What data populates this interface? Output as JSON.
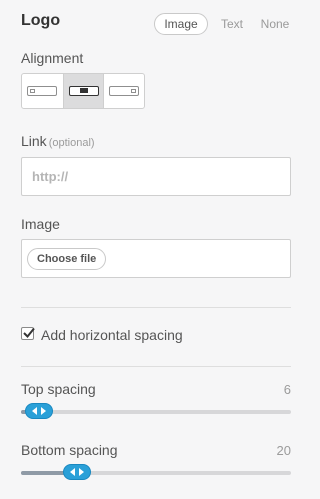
{
  "header": {
    "title": "Logo"
  },
  "mode_tabs": [
    "Image",
    "Text",
    "None"
  ],
  "alignment": {
    "label": "Alignment",
    "selected": "center",
    "options": [
      "left",
      "center",
      "right"
    ]
  },
  "link": {
    "label": "Link",
    "optional": "(optional)",
    "placeholder": "http://"
  },
  "image": {
    "label": "Image",
    "button": "Choose file"
  },
  "spacing": {
    "checkbox_label": "Add horizontal spacing",
    "checked": true
  },
  "top_spacing": {
    "label": "Top spacing",
    "value": "6"
  },
  "bottom_spacing": {
    "label": "Bottom spacing",
    "value": "20"
  },
  "colors": {
    "accent": "#2aa0d8",
    "background": "#f6f6f7"
  }
}
